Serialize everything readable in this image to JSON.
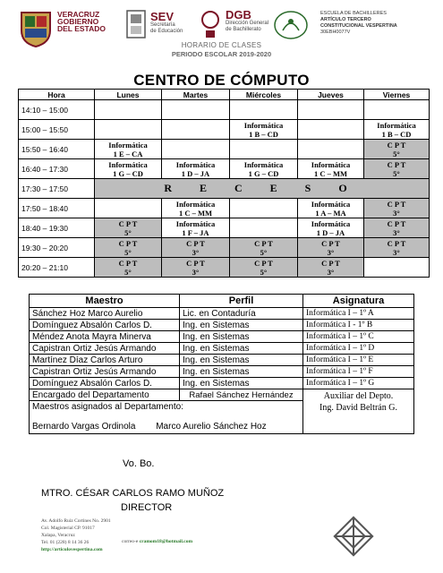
{
  "header": {
    "veracruz_lines": [
      "VERACRUZ",
      "GOBIERNO",
      "DEL ESTADO"
    ],
    "sev_title": "SEV",
    "sev_sub": [
      "Secretaría",
      "de Educación"
    ],
    "dgb_title": "DGB",
    "dgb_sub": [
      "Dirección General",
      "de Bachillerato"
    ],
    "school_lines": [
      "ESCUELA DE BACHILLERES",
      "ARTÍCULO TERCERO",
      "CONSTITUCIONAL VESPERTINA",
      "30EBH0077V"
    ],
    "horario": "HORARIO DE CLASES",
    "periodo": "PERIODO ESCOLAR 2019-2020"
  },
  "title": "CENTRO DE CÓMPUTO",
  "schedule": {
    "headers": [
      "Hora",
      "Lunes",
      "Martes",
      "Miércoles",
      "Jueves",
      "Viernes"
    ],
    "rows": [
      {
        "hora": "14:10 – 15:00",
        "cells": [
          "",
          "",
          "",
          "",
          ""
        ]
      },
      {
        "hora": "15:00 – 15:50",
        "cells": [
          "",
          "",
          "Informática\n1 B – CD",
          "",
          "Informática\n1 B – CD"
        ]
      },
      {
        "hora": "15:50 – 16:40",
        "cells": [
          "Informática\n1 E – CA",
          "",
          "",
          "",
          "C P T\n5°"
        ]
      },
      {
        "hora": "16:40 – 17:30",
        "cells": [
          "Informática\n1 G – CD",
          "Informática\n1 D – JA",
          "Informática\n1 G – CD",
          "Informática\n1 C – MM",
          "C P T\n5°"
        ]
      },
      {
        "hora": "17:30 – 17:50",
        "receso": "R E C E S O"
      },
      {
        "hora": "17:50 – 18:40",
        "cells": [
          "",
          "Informática\n1 C – MM",
          "",
          "Informática\n1 A – MA",
          "C P T\n3°"
        ]
      },
      {
        "hora": "18:40 – 19:30",
        "cells": [
          "C P T\n5°",
          "Informática\n1 F – JA",
          "",
          "Informática\n1 D – JA",
          "C P T\n3°"
        ]
      },
      {
        "hora": "19:30 – 20:20",
        "cells": [
          "C P T\n5°",
          "C P T\n3°",
          "C P T\n5°",
          "C P T\n3°",
          "C P T\n3°"
        ]
      },
      {
        "hora": "20:20 – 21:10",
        "cells": [
          "C P T\n5°",
          "C P T\n3°",
          "C P T\n5°",
          "C P T\n3°",
          ""
        ]
      }
    ]
  },
  "teachers": {
    "headers": [
      "Maestro",
      "Perfil",
      "Asignatura"
    ],
    "rows": [
      {
        "maestro": "Sánchez Hoz Marco Aurelio",
        "perfil": "Lic. en Contaduría",
        "asignatura": "Informática I –  1º  A"
      },
      {
        "maestro": "Domínguez Absalón Carlos D.",
        "perfil": "Ing. en Sistemas",
        "asignatura": "Informática I -  1º  B"
      },
      {
        "maestro": "Méndez Anota Mayra Minerva",
        "perfil": "Ing. en Sistemas",
        "asignatura": "Informática I –  1º  C"
      },
      {
        "maestro": "Capistran Ortiz Jesús Armando",
        "perfil": "Ing. en Sistemas",
        "asignatura": "Informática I –  1º  D"
      },
      {
        "maestro": "Martínez Díaz Carlos Arturo",
        "perfil": "Ing. en Sistemas",
        "asignatura": "Informática I –  1º  E"
      },
      {
        "maestro": "Capistran Ortiz Jesús Armando",
        "perfil": "Ing. en Sistemas",
        "asignatura": "Informática I –  1º  F"
      },
      {
        "maestro": "Domínguez Absalón Carlos D.",
        "perfil": "Ing. en Sistemas",
        "asignatura": "Informática I –  1º  G"
      }
    ],
    "encargado_label": "Encargado del Departamento",
    "encargado_name": "Rafael Sánchez Hernández",
    "aux_label": "Auxiliar del Depto.",
    "aux_name": "Ing. David Beltrán G.",
    "asignados_label": "Maestros asignados al Departamento:",
    "asignado_1": "Bernardo Vargas Ordinola",
    "asignado_2": "Marco Aurelio Sánchez Hoz"
  },
  "signature": {
    "vobo": "Vo. Bo.",
    "name": "MTRO. CÉSAR CARLOS RAMO MUÑOZ",
    "role": "DIRECTOR"
  },
  "footer": {
    "address": [
      "Av. Adolfo Ruiz Cortines No. 2901",
      "Col. Magisterial   CP. 91017",
      "Xalapa, Veracruz",
      "Tel. 01 (228) 8 14 36 26"
    ],
    "web": "http://articulovespertina.com",
    "email_label": "correo-e",
    "email": "cramom18@hotmail.com"
  },
  "colors": {
    "brand": "#7a1426",
    "shade": "#bdbdbd",
    "link": "#2a7a2a"
  }
}
